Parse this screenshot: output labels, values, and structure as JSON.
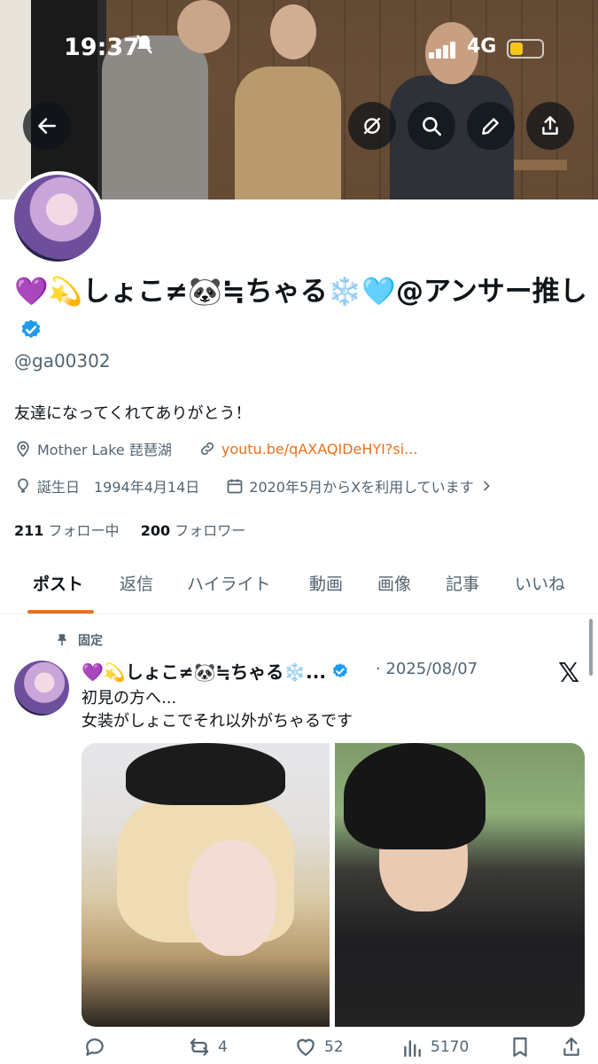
{
  "status_bar": {
    "time": "19:37",
    "network": "4G"
  },
  "profile": {
    "display_name": "💜💫しょこ≠🐼≒ちゃる❄️🩵@アンサー推し",
    "handle": "@ga00302",
    "bio": "友達になってくれてありがとう！",
    "location": "Mother Lake 琵琶湖",
    "link": "youtu.be/qAXAQIDeHYI?si...",
    "birthday": "誕生日　1994年4月14日",
    "joined": "2020年5月からXを利用しています",
    "following_count": "211",
    "following_label": "フォロー中",
    "followers_count": "200",
    "followers_label": "フォロワー"
  },
  "tabs": [
    "ポスト",
    "返信",
    "ハイライト",
    "動画",
    "画像",
    "記事",
    "いいね"
  ],
  "post": {
    "pinned_label": "固定",
    "author": "💜💫しょこ≠🐼≒ちゃる❄️...",
    "date": "· 2025/08/07",
    "line1": "初見の方へ...",
    "line2": "女装がしょこでそれ以外がちゃるです",
    "retweets": "4",
    "likes": "52",
    "views": "5170"
  },
  "colors": {
    "accent": "#e8711c",
    "verified": "#1d9bf0",
    "muted": "#536471"
  }
}
